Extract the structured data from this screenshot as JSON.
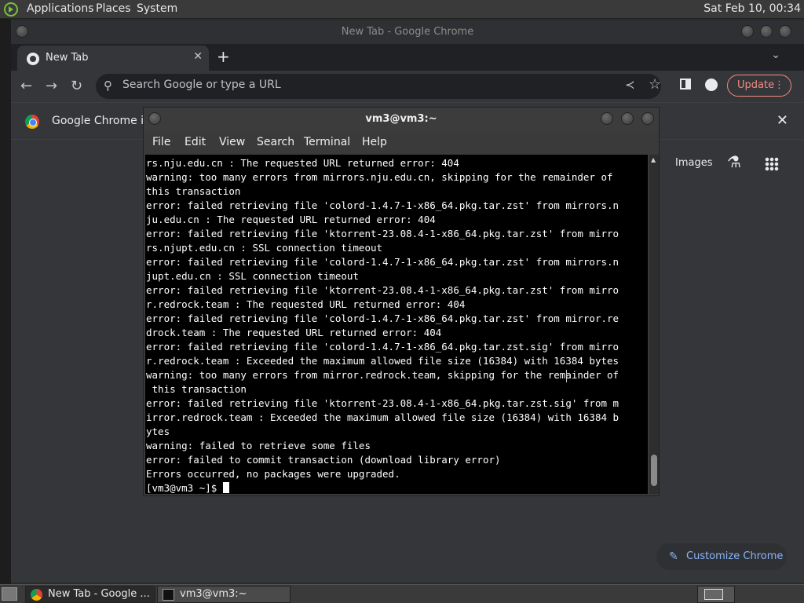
{
  "panel": {
    "menus": [
      "Applications",
      "Places",
      "System"
    ],
    "clock": "Sat Feb 10, 00:34"
  },
  "chrome": {
    "window_title": "New Tab - Google Chrome",
    "tab_label": "New Tab",
    "tab_close": "✕",
    "new_tab": "+",
    "tab_search": "⌄",
    "omnibox_placeholder": "Search Google or type a URL",
    "update_label": "Update",
    "infobar_text": "Google Chrome isn",
    "ntp": {
      "images_link": "Images",
      "customize_label": "Customize Chrome"
    }
  },
  "terminal": {
    "title": "vm3@vm3:~",
    "menus": [
      "File",
      "Edit",
      "View",
      "Search",
      "Terminal",
      "Help"
    ],
    "lines": [
      "rs.nju.edu.cn : The requested URL returned error: 404",
      "warning: too many errors from mirrors.nju.edu.cn, skipping for the remainder of",
      "this transaction",
      "error: failed retrieving file 'colord-1.4.7-1-x86_64.pkg.tar.zst' from mirrors.n",
      "ju.edu.cn : The requested URL returned error: 404",
      "error: failed retrieving file 'ktorrent-23.08.4-1-x86_64.pkg.tar.zst' from mirro",
      "rs.njupt.edu.cn : SSL connection timeout",
      "error: failed retrieving file 'colord-1.4.7-1-x86_64.pkg.tar.zst' from mirrors.n",
      "jupt.edu.cn : SSL connection timeout",
      "error: failed retrieving file 'ktorrent-23.08.4-1-x86_64.pkg.tar.zst' from mirro",
      "r.redrock.team : The requested URL returned error: 404",
      "error: failed retrieving file 'colord-1.4.7-1-x86_64.pkg.tar.zst' from mirror.re",
      "drock.team : The requested URL returned error: 404",
      "error: failed retrieving file 'colord-1.4.7-1-x86_64.pkg.tar.zst.sig' from mirro",
      "r.redrock.team : Exceeded the maximum allowed file size (16384) with 16384 bytes",
      "warning: too many errors from mirror.redrock.team, skipping for the remainder of",
      " this transaction",
      "error: failed retrieving file 'ktorrent-23.08.4-1-x86_64.pkg.tar.zst.sig' from m",
      "irror.redrock.team : Exceeded the maximum allowed file size (16384) with 16384 b",
      "ytes",
      "warning: failed to retrieve some files",
      "error: failed to commit transaction (download library error)",
      "Errors occurred, no packages were upgraded."
    ],
    "prompt": "[vm3@vm3 ~]$ "
  },
  "taskbar": {
    "tasks": [
      "New Tab - Google ...",
      "vm3@vm3:~"
    ]
  },
  "icons": {
    "back": "arrow-left-icon",
    "forward": "arrow-right-icon",
    "reload": "reload-icon",
    "search": "search-icon",
    "share": "share-icon",
    "bookmark": "star-icon",
    "side_panel": "side-panel-icon",
    "profile": "profile-icon",
    "labs": "flask-icon",
    "apps": "apps-grid-icon",
    "customize": "pencil-icon"
  },
  "colors": {
    "update_accent": "#f28b82",
    "link_blue": "#8ab4f8",
    "terminal_bg": "#000000",
    "terminal_fg": "#ffffff"
  }
}
